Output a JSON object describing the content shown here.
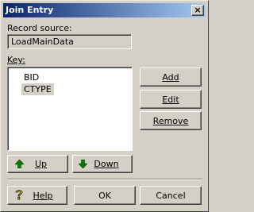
{
  "window": {
    "title": "Join Entry",
    "close_glyph": "×"
  },
  "record_source": {
    "label": "Record source:",
    "value": "LoadMainData"
  },
  "key": {
    "label": "Key:",
    "items": [
      {
        "label": "BID",
        "selected": false
      },
      {
        "label": "CTYPE",
        "selected": true
      }
    ]
  },
  "buttons": {
    "add": "Add",
    "edit": "Edit",
    "remove": "Remove",
    "up": "Up",
    "down": "Down",
    "help": "Help",
    "ok": "OK",
    "cancel": "Cancel"
  },
  "icons": {
    "close": "close-icon",
    "up": "arrow-up-icon",
    "down": "arrow-down-icon",
    "help": "help-question-icon"
  },
  "colors": {
    "title_gradient_start": "#0a246a",
    "title_gradient_end": "#a6caf0",
    "arrow_green": "#008000",
    "help_yellow": "#ffff00"
  }
}
